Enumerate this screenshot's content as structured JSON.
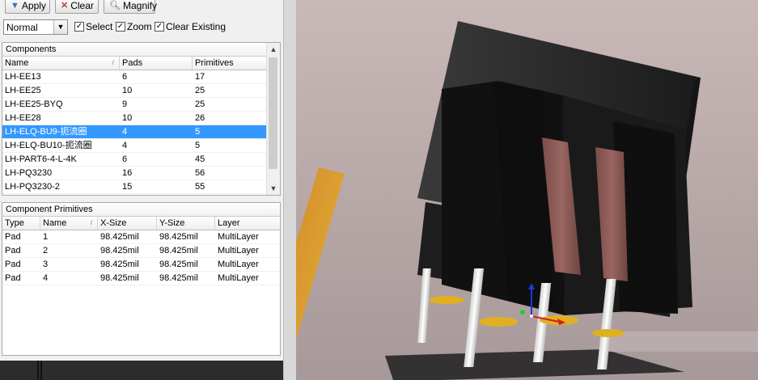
{
  "toolbar": {
    "apply_label": "Apply",
    "clear_label": "Clear",
    "magnify_label": "Magnify",
    "mode_value": "Normal",
    "select_label": "Select",
    "zoom_label": "Zoom",
    "clear_existing_label": "Clear Existing"
  },
  "components": {
    "title": "Components",
    "columns": [
      "Name",
      "Pads",
      "Primitives"
    ],
    "rows": [
      [
        "LH-EE13",
        "6",
        "17"
      ],
      [
        "LH-EE25",
        "10",
        "25"
      ],
      [
        "LH-EE25-BYQ",
        "9",
        "25"
      ],
      [
        "LH-EE28",
        "10",
        "26"
      ],
      [
        "LH-ELQ-BU9-扼流圈",
        "4",
        "5"
      ],
      [
        "LH-ELQ-BU10-扼流圈",
        "4",
        "5"
      ],
      [
        "LH-PART6-4-L-4K",
        "6",
        "45"
      ],
      [
        "LH-PQ3230",
        "16",
        "56"
      ],
      [
        "LH-PQ3230-2",
        "15",
        "55"
      ]
    ],
    "selected_index": 4
  },
  "primitives": {
    "title": "Component Primitives",
    "columns": [
      "Type",
      "Name",
      "X-Size",
      "Y-Size",
      "Layer"
    ],
    "rows": [
      [
        "Pad",
        "1",
        "98.425mil",
        "98.425mil",
        "MultiLayer"
      ],
      [
        "Pad",
        "2",
        "98.425mil",
        "98.425mil",
        "MultiLayer"
      ],
      [
        "Pad",
        "3",
        "98.425mil",
        "98.425mil",
        "MultiLayer"
      ],
      [
        "Pad",
        "4",
        "98.425mil",
        "98.425mil",
        "MultiLayer"
      ]
    ]
  },
  "colors": {
    "selection": "#3399ff",
    "viewport_top": "#c8b6b6",
    "viewport_bottom": "#a99b9b",
    "body": "#232323",
    "winding": "#8a5a56",
    "pad": "#e0b020"
  }
}
